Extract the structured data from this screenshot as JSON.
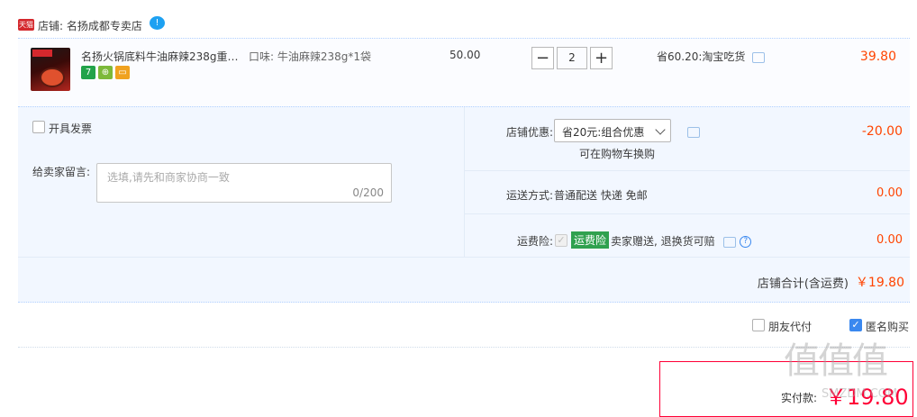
{
  "store": {
    "badge": "天猫",
    "label": "店铺: 名扬成都专卖店",
    "chat_glyph": "!"
  },
  "item": {
    "title": "名扬火锅底料牛油麻辣238g重…",
    "sku": "口味: 牛油麻辣238g*1袋",
    "unit_price": "50.00",
    "quantity": "2",
    "minus": "−",
    "plus": "+",
    "saving": "省60.20:淘宝吃货",
    "total": "39.80",
    "service_icons": [
      "7",
      "⊕",
      "▭"
    ]
  },
  "options": {
    "invoice_label": "开具发票",
    "message_label": "给卖家留言:",
    "message_placeholder": "选填,请先和商家协商一致",
    "message_count": "0/200",
    "coupon_label": "店铺优惠:",
    "coupon_value": "省20元:组合优惠",
    "coupon_sub": "可在购物车换购",
    "coupon_amount": "-20.00",
    "shipping_label": "运送方式:",
    "shipping_value": "普通配送 快递 免邮",
    "shipping_amount": "0.00",
    "insurance_label": "运费险:",
    "insurance_badge": "运费险",
    "insurance_text": "卖家赠送, 退换货可赔",
    "insurance_amount": "0.00",
    "store_total_label": "店铺合计(含运费)",
    "store_total_value": "￥19.80"
  },
  "bottom": {
    "friend_pay_label": "朋友代付",
    "anonymous_label": "匿名购买",
    "final_label": "实付款:",
    "final_amount": "￥19.80"
  },
  "watermark": {
    "glyphs": "值值值",
    "url": "SMZDM.COM"
  },
  "colors": {
    "price_red": "#ff4400",
    "accent_blue": "#3a88ef",
    "tmall_red": "#d4282d",
    "insurance_green": "#30a14e"
  }
}
